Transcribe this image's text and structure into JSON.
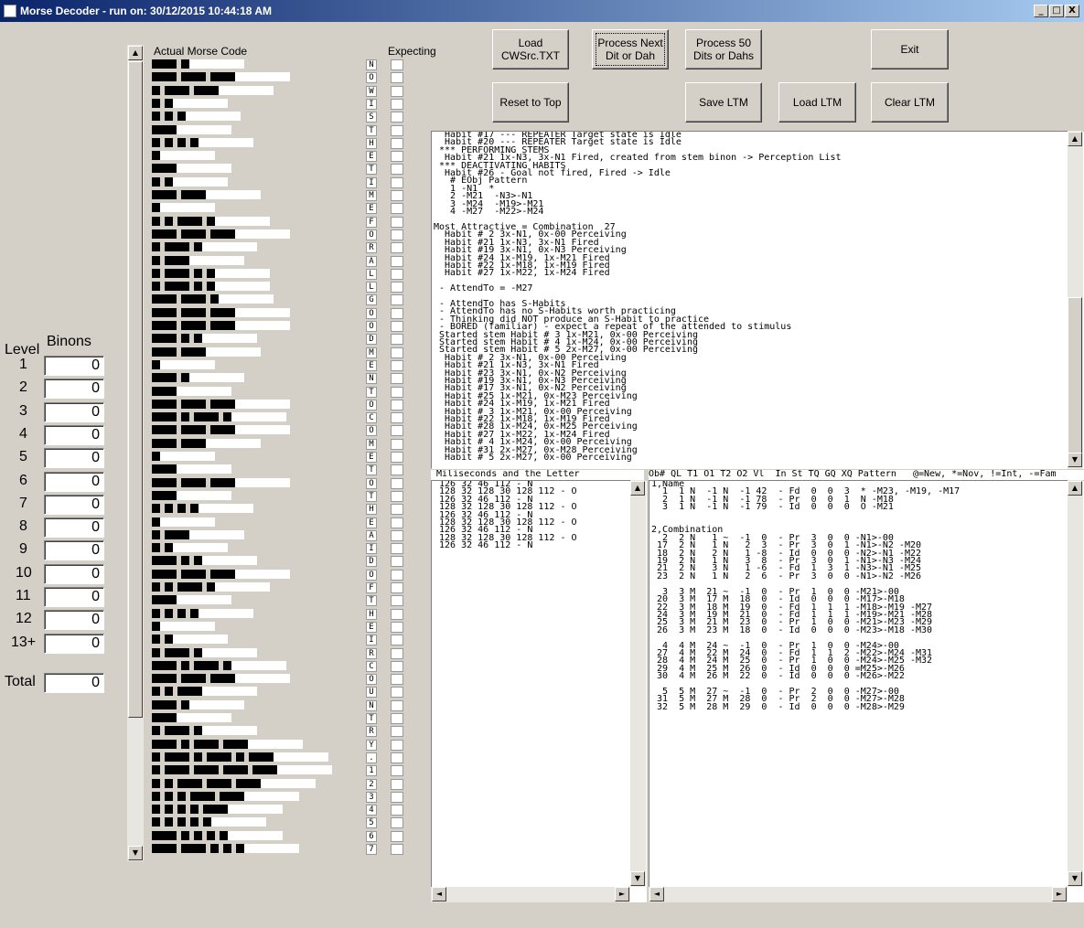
{
  "window": {
    "title": "Morse Decoder - run on: 30/12/2015  10:44:18 AM",
    "minimize": "_",
    "maximize": "□",
    "close": "X"
  },
  "buttons": {
    "load": "Load\nCWSrc.TXT",
    "process_next": "Process Next\nDit or Dah",
    "process50": "Process 50\nDits or Dahs",
    "exit": "Exit",
    "reset": "Reset to Top",
    "save_ltm": "Save LTM",
    "load_ltm": "Load LTM",
    "clear_ltm": "Clear LTM"
  },
  "labels": {
    "actual": "Actual Morse Code",
    "expecting": "Expecting",
    "level": "Level",
    "binons": "Binons",
    "total": "Total"
  },
  "levels": [
    {
      "label": "1",
      "value": "0"
    },
    {
      "label": "2",
      "value": "0"
    },
    {
      "label": "3",
      "value": "0"
    },
    {
      "label": "4",
      "value": "0"
    },
    {
      "label": "5",
      "value": "0"
    },
    {
      "label": "6",
      "value": "0"
    },
    {
      "label": "7",
      "value": "0"
    },
    {
      "label": "8",
      "value": "0"
    },
    {
      "label": "9",
      "value": "0"
    },
    {
      "label": "10",
      "value": "0"
    },
    {
      "label": "11",
      "value": "0"
    },
    {
      "label": "12",
      "value": "0"
    },
    {
      "label": "13+",
      "value": "0"
    }
  ],
  "total_value": "0",
  "morse_rows": [
    {
      "letter": "N",
      "code": "-."
    },
    {
      "letter": "O",
      "code": "---"
    },
    {
      "letter": "W",
      "code": ".--"
    },
    {
      "letter": "I",
      "code": ".."
    },
    {
      "letter": "S",
      "code": "..."
    },
    {
      "letter": "T",
      "code": "-"
    },
    {
      "letter": "H",
      "code": "...."
    },
    {
      "letter": "E",
      "code": "."
    },
    {
      "letter": "T",
      "code": "-"
    },
    {
      "letter": "I",
      "code": ".."
    },
    {
      "letter": "M",
      "code": "--"
    },
    {
      "letter": "E",
      "code": "."
    },
    {
      "letter": "F",
      "code": "..-."
    },
    {
      "letter": "O",
      "code": "---"
    },
    {
      "letter": "R",
      "code": ".-."
    },
    {
      "letter": "A",
      "code": ".-"
    },
    {
      "letter": "L",
      "code": ".-.."
    },
    {
      "letter": "L",
      "code": ".-.."
    },
    {
      "letter": "G",
      "code": "--."
    },
    {
      "letter": "O",
      "code": "---"
    },
    {
      "letter": "O",
      "code": "---"
    },
    {
      "letter": "D",
      "code": "-.."
    },
    {
      "letter": "M",
      "code": "--"
    },
    {
      "letter": "E",
      "code": "."
    },
    {
      "letter": "N",
      "code": "-."
    },
    {
      "letter": "T",
      "code": "-"
    },
    {
      "letter": "O",
      "code": "---"
    },
    {
      "letter": "C",
      "code": "-.-."
    },
    {
      "letter": "O",
      "code": "---"
    },
    {
      "letter": "M",
      "code": "--"
    },
    {
      "letter": "E",
      "code": "."
    },
    {
      "letter": "T",
      "code": "-"
    },
    {
      "letter": "O",
      "code": "---"
    },
    {
      "letter": "T",
      "code": "-"
    },
    {
      "letter": "H",
      "code": "...."
    },
    {
      "letter": "E",
      "code": "."
    },
    {
      "letter": "A",
      "code": ".-"
    },
    {
      "letter": "I",
      "code": ".."
    },
    {
      "letter": "D",
      "code": "-.."
    },
    {
      "letter": "O",
      "code": "---"
    },
    {
      "letter": "F",
      "code": "..-."
    },
    {
      "letter": "T",
      "code": "-"
    },
    {
      "letter": "H",
      "code": "...."
    },
    {
      "letter": "E",
      "code": "."
    },
    {
      "letter": "I",
      "code": ".."
    },
    {
      "letter": "R",
      "code": ".-."
    },
    {
      "letter": "C",
      "code": "-.-."
    },
    {
      "letter": "O",
      "code": "---"
    },
    {
      "letter": "U",
      "code": "..-"
    },
    {
      "letter": "N",
      "code": "-."
    },
    {
      "letter": "T",
      "code": "-"
    },
    {
      "letter": "R",
      "code": ".-."
    },
    {
      "letter": "Y",
      "code": "-.--"
    },
    {
      "letter": ".",
      "code": ".-.-.-"
    },
    {
      "letter": "1",
      "code": ".----"
    },
    {
      "letter": "2",
      "code": "..---"
    },
    {
      "letter": "3",
      "code": "...--"
    },
    {
      "letter": "4",
      "code": "....-"
    },
    {
      "letter": "5",
      "code": "....."
    },
    {
      "letter": "6",
      "code": "-...."
    },
    {
      "letter": "7",
      "code": "--..."
    }
  ],
  "habits_text": "  Habit #17 --- REPEATER Target state is Idle\n  Habit #20 --- REPEATER Target state is Idle\n *** PERFORMING STEMS\n  Habit #21 1x-N3, 3x-N1 Fired, created from stem binon -> Perception List\n *** DEACTIVATING HABITS\n  Habit #26 - Goal not fired, Fired -> Idle\n   # EObj Pattern\n   1 -N1  *\n   2 -M21  -N3>-N1\n   3 -M24  -M19>-M21\n   4 -M27  -M22>-M24\n\nMost Attractive = Combination  27\n  Habit # 2 3x-N1, 0x-00 Perceiving\n  Habit #21 1x-N3, 3x-N1 Fired\n  Habit #19 3x-N1, 0x-N3 Perceiving\n  Habit #24 1x-M19, 1x-M21 Fired\n  Habit #22 1x-M18, 1x-M19 Fired\n  Habit #27 1x-M22, 1x-M24 Fired\n\n - AttendTo = -M27\n\n - AttendTo has S-Habits\n - AttendTo has no S-Habits worth practicing\n - Thinking did NOT produce an S-Habit to practice\n - BORED (familiar) - expect a repeat of the attended to stimulus\n Started stem Habit # 3 1x-M21, 0x-00 Perceiving\n Started stem Habit # 4 1x-M24, 0x-00 Perceiving\n Started stem Habit # 5 2x-M27, 0x-00 Perceiving\n  Habit # 2 3x-N1, 0x-00 Perceiving\n  Habit #21 1x-N3, 3x-N1 Fired\n  Habit #23 3x-N1, 0x-N2 Perceiving\n  Habit #19 3x-N1, 0x-N3 Perceiving\n  Habit #17 3x-N1, 0x-N2 Perceiving\n  Habit #25 1x-M21, 0x-M23 Perceiving\n  Habit #24 1x-M19, 1x-M21 Fired\n  Habit # 3 1x-M21, 0x-00 Perceiving\n  Habit #22 1x-M18, 1x-M19 Fired\n  Habit #28 1x-M24, 0x-M25 Perceiving\n  Habit #27 1x-M22, 1x-M24 Fired\n  Habit # 4 1x-M24, 0x-00 Perceiving\n  Habit #31 2x-M27, 0x-M28 Perceiving\n  Habit # 5 2x-M27, 0x-00 Perceiving",
  "ms_header": " Miliseconds and the Letter",
  "ms_text": " 126 32 46 112 - N\n 128 32 128 30 128 112 - O\n 126 32 46 112 - N\n 128 32 128 30 128 112 - O\n 126 32 46 112 - N\n 128 32 128 30 128 112 - O\n 126 32 46 112 - N\n 128 32 128 30 128 112 - O\n 126 32 46 112 - N",
  "obj_header": "Ob# QL T1 O1 T2 O2 Vl  In St TQ GQ XQ Pattern   @=New, *=Nov, !=Int, -=Fam",
  "obj_text": "1,Name\n  1  1 N  -1 N  -1 42  - Fd  0  0  3  * -M23, -M19, -M17\n  2  1 N  -1 N  -1 78  - Pr  0  0  1  N -M18\n  3  1 N  -1 N  -1 79  - Id  0  0  0  O -M21\n\n\n2,Combination\n  2  2 N   1 ~  -1  0  - Pr  3  0  0 -N1>-00\n 17  2 N   1 N   2  3  - Pr  3  0  1 -N1>-N2 -M20\n 18  2 N   2 N   1 -8  - Id  0  0  0 -N2>-N1 -M22\n 19  2 N   1 N   3  8  - Pr  3  0  1 -N1>-N3 -M24\n 21  2 N   3 N   1 -6  - Fd  1  3  1 -N3>-N1 -M25\n 23  2 N   1 N   2  6  - Pr  3  0  0 -N1>-N2 -M26\n\n  3  3 M  21 ~  -1  0  - Pr  1  0  0 -M21>-00\n 20  3 M  17 M  18  0  - Id  0  0  0 -M17>-M18\n 22  3 M  18 M  19  0  - Fd  1  1  1 -M18>-M19 -M27\n 24  3 M  19 M  21  0  - Fd  1  1  1 -M19>-M21 -M28\n 25  3 M  21 M  23  0  - Pr  1  0  0 -M21>-M23 -M29\n 26  3 M  23 M  18  0  - Id  0  0  0 -M23>-M18 -M30\n\n  4  4 M  24 ~  -1  0  - Pr  1  0  0 -M24>-00\n 27  4 M  22 M  24  0  - Fd  1  1  2 -M22>-M24 -M31\n 28  4 M  24 M  25  0  - Pr  1  0  0 -M24>-M25 -M32\n 29  4 M  25 M  26  0  - Id  0  0  0 =M25>-M26\n 30  4 M  26 M  22  0  - Id  0  0  0 -M26>-M22\n\n  5  5 M  27 ~  -1  0  - Pr  2  0  0 -M27>-00\n 31  5 M  27 M  28  0  - Pr  2  0  0 -M27>-M28\n 32  5 M  28 M  29  0  - Id  0  0  0 -M28>-M29"
}
